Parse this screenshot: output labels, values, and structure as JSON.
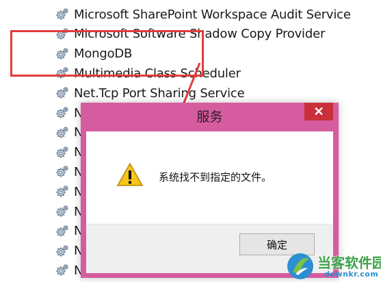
{
  "services": [
    {
      "name": "Microsoft SharePoint Workspace Audit Service",
      "icon": "gear-icon"
    },
    {
      "name": "Microsoft Software Shadow Copy Provider",
      "icon": "gear-icon"
    },
    {
      "name": "MongoDB",
      "icon": "gear-icon"
    },
    {
      "name": "Multimedia Class Scheduler",
      "icon": "gear-icon"
    },
    {
      "name": "Net.Tcp Port Sharing Service",
      "icon": "gear-icon"
    },
    {
      "name": "N",
      "icon": "gear-icon"
    },
    {
      "name": "N",
      "icon": "gear-icon"
    },
    {
      "name": "N",
      "icon": "gear-icon"
    },
    {
      "name": "N",
      "icon": "gear-icon"
    },
    {
      "name": "N",
      "icon": "gear-icon"
    },
    {
      "name": "N",
      "icon": "gear-icon"
    },
    {
      "name": "N",
      "icon": "gear-icon"
    },
    {
      "name": "N",
      "icon": "gear-icon"
    },
    {
      "name": "N",
      "icon": "gear-icon"
    }
  ],
  "dialog": {
    "title": "服务",
    "close_label": "✕",
    "message": "系统找不到指定的文件。",
    "icon": "warning-icon",
    "ok_label": "确定",
    "accent_color": "#d55c9e"
  },
  "highlight_color": "#e23b3b",
  "watermark": {
    "title": "当客软件园",
    "url": "downkr.com"
  }
}
